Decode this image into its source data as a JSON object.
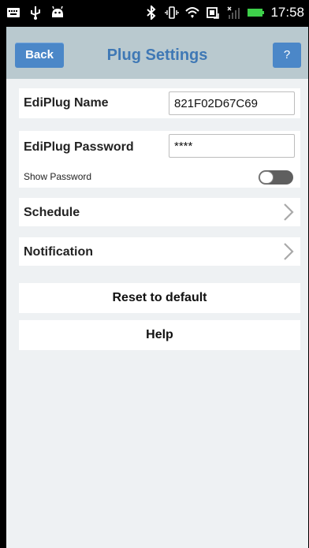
{
  "status_bar": {
    "icons": [
      "keyboard-icon",
      "usb-icon",
      "android-icon",
      "bluetooth-icon",
      "vibrate-icon",
      "wifi-icon",
      "data-sync-icon",
      "signal-icon",
      "battery-icon"
    ],
    "time": "17:58"
  },
  "header": {
    "back_label": "Back",
    "title": "Plug Settings",
    "help_label": "?"
  },
  "settings": {
    "name_label": "EdiPlug Name",
    "name_value": "821F02D67C69",
    "password_label": "EdiPlug Password",
    "password_value": "****",
    "show_password_label": "Show Password",
    "show_password_on": false,
    "schedule_label": "Schedule",
    "notification_label": "Notification"
  },
  "actions": {
    "reset_label": "Reset to default",
    "help_label": "Help"
  },
  "colors": {
    "header_bg": "#b9c9cf",
    "accent": "#4b87c8",
    "title": "#3f78b5",
    "screen_bg": "#eef1f3"
  }
}
